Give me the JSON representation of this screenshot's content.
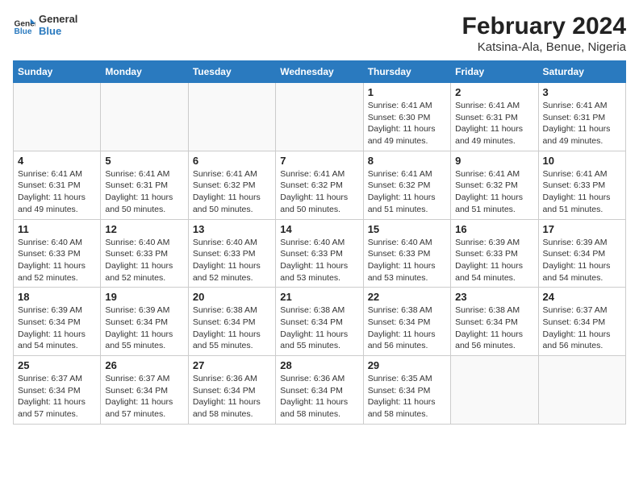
{
  "logo": {
    "general": "General",
    "blue": "Blue"
  },
  "title": "February 2024",
  "subtitle": "Katsina-Ala, Benue, Nigeria",
  "headers": [
    "Sunday",
    "Monday",
    "Tuesday",
    "Wednesday",
    "Thursday",
    "Friday",
    "Saturday"
  ],
  "weeks": [
    [
      {
        "day": "",
        "info": ""
      },
      {
        "day": "",
        "info": ""
      },
      {
        "day": "",
        "info": ""
      },
      {
        "day": "",
        "info": ""
      },
      {
        "day": "1",
        "info": "Sunrise: 6:41 AM\nSunset: 6:30 PM\nDaylight: 11 hours\nand 49 minutes."
      },
      {
        "day": "2",
        "info": "Sunrise: 6:41 AM\nSunset: 6:31 PM\nDaylight: 11 hours\nand 49 minutes."
      },
      {
        "day": "3",
        "info": "Sunrise: 6:41 AM\nSunset: 6:31 PM\nDaylight: 11 hours\nand 49 minutes."
      }
    ],
    [
      {
        "day": "4",
        "info": "Sunrise: 6:41 AM\nSunset: 6:31 PM\nDaylight: 11 hours\nand 49 minutes."
      },
      {
        "day": "5",
        "info": "Sunrise: 6:41 AM\nSunset: 6:31 PM\nDaylight: 11 hours\nand 50 minutes."
      },
      {
        "day": "6",
        "info": "Sunrise: 6:41 AM\nSunset: 6:32 PM\nDaylight: 11 hours\nand 50 minutes."
      },
      {
        "day": "7",
        "info": "Sunrise: 6:41 AM\nSunset: 6:32 PM\nDaylight: 11 hours\nand 50 minutes."
      },
      {
        "day": "8",
        "info": "Sunrise: 6:41 AM\nSunset: 6:32 PM\nDaylight: 11 hours\nand 51 minutes."
      },
      {
        "day": "9",
        "info": "Sunrise: 6:41 AM\nSunset: 6:32 PM\nDaylight: 11 hours\nand 51 minutes."
      },
      {
        "day": "10",
        "info": "Sunrise: 6:41 AM\nSunset: 6:33 PM\nDaylight: 11 hours\nand 51 minutes."
      }
    ],
    [
      {
        "day": "11",
        "info": "Sunrise: 6:40 AM\nSunset: 6:33 PM\nDaylight: 11 hours\nand 52 minutes."
      },
      {
        "day": "12",
        "info": "Sunrise: 6:40 AM\nSunset: 6:33 PM\nDaylight: 11 hours\nand 52 minutes."
      },
      {
        "day": "13",
        "info": "Sunrise: 6:40 AM\nSunset: 6:33 PM\nDaylight: 11 hours\nand 52 minutes."
      },
      {
        "day": "14",
        "info": "Sunrise: 6:40 AM\nSunset: 6:33 PM\nDaylight: 11 hours\nand 53 minutes."
      },
      {
        "day": "15",
        "info": "Sunrise: 6:40 AM\nSunset: 6:33 PM\nDaylight: 11 hours\nand 53 minutes."
      },
      {
        "day": "16",
        "info": "Sunrise: 6:39 AM\nSunset: 6:33 PM\nDaylight: 11 hours\nand 54 minutes."
      },
      {
        "day": "17",
        "info": "Sunrise: 6:39 AM\nSunset: 6:34 PM\nDaylight: 11 hours\nand 54 minutes."
      }
    ],
    [
      {
        "day": "18",
        "info": "Sunrise: 6:39 AM\nSunset: 6:34 PM\nDaylight: 11 hours\nand 54 minutes."
      },
      {
        "day": "19",
        "info": "Sunrise: 6:39 AM\nSunset: 6:34 PM\nDaylight: 11 hours\nand 55 minutes."
      },
      {
        "day": "20",
        "info": "Sunrise: 6:38 AM\nSunset: 6:34 PM\nDaylight: 11 hours\nand 55 minutes."
      },
      {
        "day": "21",
        "info": "Sunrise: 6:38 AM\nSunset: 6:34 PM\nDaylight: 11 hours\nand 55 minutes."
      },
      {
        "day": "22",
        "info": "Sunrise: 6:38 AM\nSunset: 6:34 PM\nDaylight: 11 hours\nand 56 minutes."
      },
      {
        "day": "23",
        "info": "Sunrise: 6:38 AM\nSunset: 6:34 PM\nDaylight: 11 hours\nand 56 minutes."
      },
      {
        "day": "24",
        "info": "Sunrise: 6:37 AM\nSunset: 6:34 PM\nDaylight: 11 hours\nand 56 minutes."
      }
    ],
    [
      {
        "day": "25",
        "info": "Sunrise: 6:37 AM\nSunset: 6:34 PM\nDaylight: 11 hours\nand 57 minutes."
      },
      {
        "day": "26",
        "info": "Sunrise: 6:37 AM\nSunset: 6:34 PM\nDaylight: 11 hours\nand 57 minutes."
      },
      {
        "day": "27",
        "info": "Sunrise: 6:36 AM\nSunset: 6:34 PM\nDaylight: 11 hours\nand 58 minutes."
      },
      {
        "day": "28",
        "info": "Sunrise: 6:36 AM\nSunset: 6:34 PM\nDaylight: 11 hours\nand 58 minutes."
      },
      {
        "day": "29",
        "info": "Sunrise: 6:35 AM\nSunset: 6:34 PM\nDaylight: 11 hours\nand 58 minutes."
      },
      {
        "day": "",
        "info": ""
      },
      {
        "day": "",
        "info": ""
      }
    ]
  ]
}
